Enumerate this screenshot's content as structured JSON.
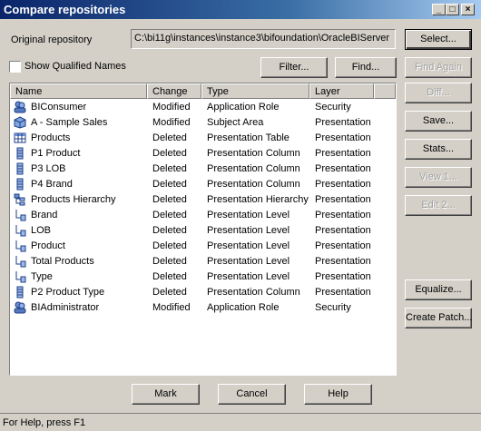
{
  "window": {
    "title": "Compare repositories",
    "minimize": "_",
    "maximize": "□",
    "close": "×"
  },
  "original_repo": {
    "label": "Original repository",
    "value": "C:\\bi11g\\instances\\instance3\\bifoundation\\OracleBIServer"
  },
  "show_qualified_names": {
    "label": "Show Qualified Names",
    "checked": false
  },
  "buttons": {
    "select": "Select...",
    "filter": "Filter...",
    "find": "Find...",
    "find_again": "Find Again",
    "diff": "Diff...",
    "save": "Save...",
    "stats": "Stats...",
    "view": "View 1...",
    "edit": "Edit 2...",
    "equalize": "Equalize...",
    "create_patch": "Create Patch...",
    "mark": "Mark",
    "cancel": "Cancel",
    "help": "Help"
  },
  "table": {
    "columns": [
      "Name",
      "Change",
      "Type",
      "Layer"
    ],
    "rows": [
      {
        "icon": "application-role-icon",
        "name": "BIConsumer",
        "change": "Modified",
        "type": "Application Role",
        "layer": "Security"
      },
      {
        "icon": "subject-area-icon",
        "name": "A - Sample Sales",
        "change": "Modified",
        "type": "Subject Area",
        "layer": "Presentation"
      },
      {
        "icon": "presentation-table-icon",
        "name": "Products",
        "change": "Deleted",
        "type": "Presentation Table",
        "layer": "Presentation"
      },
      {
        "icon": "presentation-column-icon",
        "name": "P1  Product",
        "change": "Deleted",
        "type": "Presentation Column",
        "layer": "Presentation"
      },
      {
        "icon": "presentation-column-icon",
        "name": "P3  LOB",
        "change": "Deleted",
        "type": "Presentation Column",
        "layer": "Presentation"
      },
      {
        "icon": "presentation-column-icon",
        "name": "P4  Brand",
        "change": "Deleted",
        "type": "Presentation Column",
        "layer": "Presentation"
      },
      {
        "icon": "presentation-hierarchy-icon",
        "name": "Products Hierarchy",
        "change": "Deleted",
        "type": "Presentation Hierarchy",
        "layer": "Presentation"
      },
      {
        "icon": "presentation-level-icon",
        "name": "Brand",
        "change": "Deleted",
        "type": "Presentation Level",
        "layer": "Presentation"
      },
      {
        "icon": "presentation-level-icon",
        "name": "LOB",
        "change": "Deleted",
        "type": "Presentation Level",
        "layer": "Presentation"
      },
      {
        "icon": "presentation-level-icon",
        "name": "Product",
        "change": "Deleted",
        "type": "Presentation Level",
        "layer": "Presentation"
      },
      {
        "icon": "presentation-level-icon",
        "name": "Total Products",
        "change": "Deleted",
        "type": "Presentation Level",
        "layer": "Presentation"
      },
      {
        "icon": "presentation-level-icon",
        "name": "Type",
        "change": "Deleted",
        "type": "Presentation Level",
        "layer": "Presentation"
      },
      {
        "icon": "presentation-column-icon",
        "name": "P2  Product Type",
        "change": "Deleted",
        "type": "Presentation Column",
        "layer": "Presentation"
      },
      {
        "icon": "application-role-icon",
        "name": "BIAdministrator",
        "change": "Modified",
        "type": "Application Role",
        "layer": "Security"
      }
    ]
  },
  "status": "For Help, press F1"
}
